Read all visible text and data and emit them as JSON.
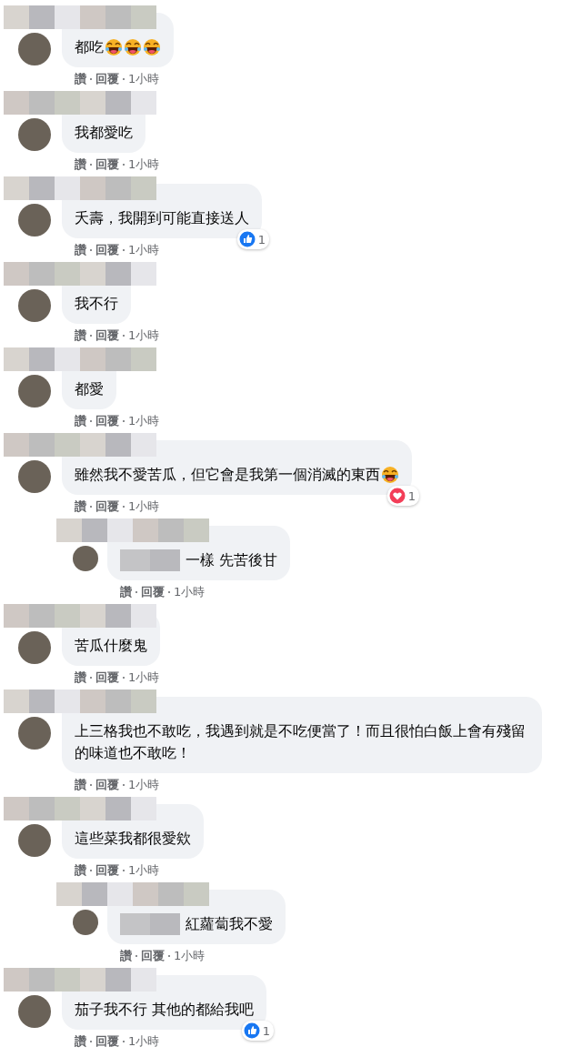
{
  "comments": [
    {
      "kind": "comment",
      "text": "都吃",
      "emojis": [
        {
          "kind": "laugh"
        },
        {
          "kind": "laugh"
        },
        {
          "kind": "laugh"
        }
      ],
      "meta": {
        "like": "讚",
        "reply": "回覆",
        "time": "1小時"
      }
    },
    {
      "kind": "comment",
      "text": "我都愛吃",
      "meta": {
        "like": "讚",
        "reply": "回覆",
        "time": "1小時"
      }
    },
    {
      "kind": "comment",
      "text": "夭壽，我開到可能直接送人",
      "reaction": {
        "kind": "like",
        "count": "1"
      },
      "meta": {
        "like": "讚",
        "reply": "回覆",
        "time": "1小時"
      }
    },
    {
      "kind": "comment",
      "text": "我不行",
      "meta": {
        "like": "讚",
        "reply": "回覆",
        "time": "1小時"
      }
    },
    {
      "kind": "comment",
      "text": "都愛",
      "meta": {
        "like": "讚",
        "reply": "回覆",
        "time": "1小時"
      }
    },
    {
      "kind": "comment",
      "text": "雖然我不愛苦瓜，但它會是我第一個消滅的東西",
      "emojis": [
        {
          "kind": "laugh"
        }
      ],
      "reaction": {
        "kind": "love",
        "count": "1"
      },
      "meta": {
        "like": "讚",
        "reply": "回覆",
        "time": "1小時"
      }
    },
    {
      "kind": "reply",
      "mention_hidden": true,
      "text": "一樣 先苦後甘",
      "meta": {
        "like": "讚",
        "reply": "回覆",
        "time": "1小時"
      }
    },
    {
      "kind": "comment",
      "text": "苦瓜什麼鬼",
      "meta": {
        "like": "讚",
        "reply": "回覆",
        "time": "1小時"
      }
    },
    {
      "kind": "comment",
      "text": "上三格我也不敢吃，我遇到就是不吃便當了！而且很怕白飯上會有殘留的味道也不敢吃！",
      "meta": {
        "like": "讚",
        "reply": "回覆",
        "time": "1小時"
      }
    },
    {
      "kind": "comment",
      "text": "這些菜我都很愛欸",
      "meta": {
        "like": "讚",
        "reply": "回覆",
        "time": "1小時"
      }
    },
    {
      "kind": "reply",
      "mention_hidden": true,
      "text": "紅蘿蔔我不愛",
      "meta": {
        "like": "讚",
        "reply": "回覆",
        "time": "1小時"
      }
    },
    {
      "kind": "comment",
      "text": "茄子我不行 其他的都給我吧",
      "reaction": {
        "kind": "like",
        "count": "1"
      },
      "meta": {
        "like": "讚",
        "reply": "回覆",
        "time": "1小時"
      }
    }
  ]
}
